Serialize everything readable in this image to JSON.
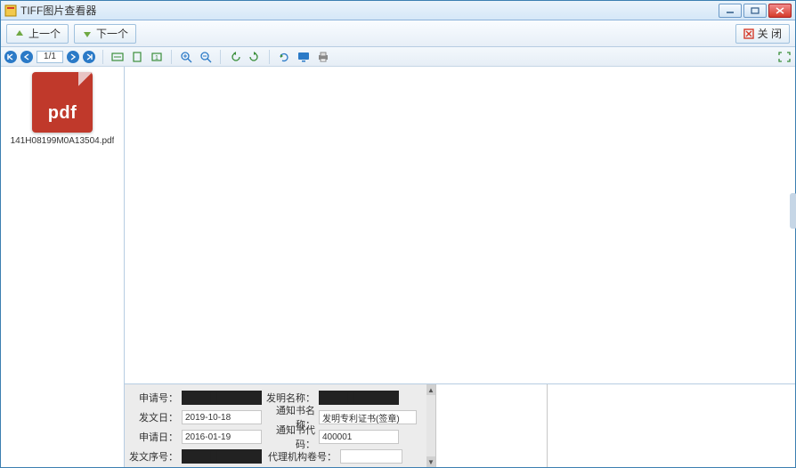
{
  "titlebar": {
    "title": "TIFF图片查看器"
  },
  "toprow": {
    "prev_label": "上一个",
    "next_label": "下一个",
    "close_label": "关 闭"
  },
  "nav": {
    "page_display": "1/1"
  },
  "thumbnail": {
    "doc_type": "pdf",
    "filename": "141H08199M0A13504.pdf"
  },
  "form": {
    "labels": {
      "application_no": "申请号：",
      "invention_name": "发明名称：",
      "issue_date": "发文日：",
      "notice_name": "通知书名称：",
      "application_date": "申请日：",
      "notice_code": "通知书代码：",
      "issue_sequence": "发文序号：",
      "agency_no": "代理机构卷号："
    },
    "values": {
      "application_no": "██████",
      "invention_name": "██████",
      "issue_date": "2019-10-18",
      "notice_name": "发明专利证书(签章)",
      "application_date": "2016-01-19",
      "notice_code": "400001",
      "issue_sequence": "██████",
      "agency_no": ""
    }
  }
}
